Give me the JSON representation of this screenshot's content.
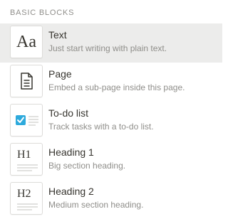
{
  "section": {
    "header": "BASIC BLOCKS"
  },
  "blocks": [
    {
      "title": "Text",
      "description": "Just start writing with plain text.",
      "icon": "text-aa-icon",
      "glyph": "Aa",
      "selected": true
    },
    {
      "title": "Page",
      "description": "Embed a sub-page inside this page.",
      "icon": "page-document-icon",
      "selected": false
    },
    {
      "title": "To-do list",
      "description": "Track tasks with a to-do list.",
      "icon": "checkbox-list-icon",
      "selected": false
    },
    {
      "title": "Heading 1",
      "description": "Big section heading.",
      "icon": "heading-1-icon",
      "glyph": "H1",
      "selected": false
    },
    {
      "title": "Heading 2",
      "description": "Medium section heading.",
      "icon": "heading-2-icon",
      "glyph": "H2",
      "selected": false
    }
  ],
  "colors": {
    "selected_bg": "#ececeb",
    "checkbox_blue": "#2eaadc",
    "text_primary": "#37352f",
    "text_secondary": "#8f8e8a"
  }
}
